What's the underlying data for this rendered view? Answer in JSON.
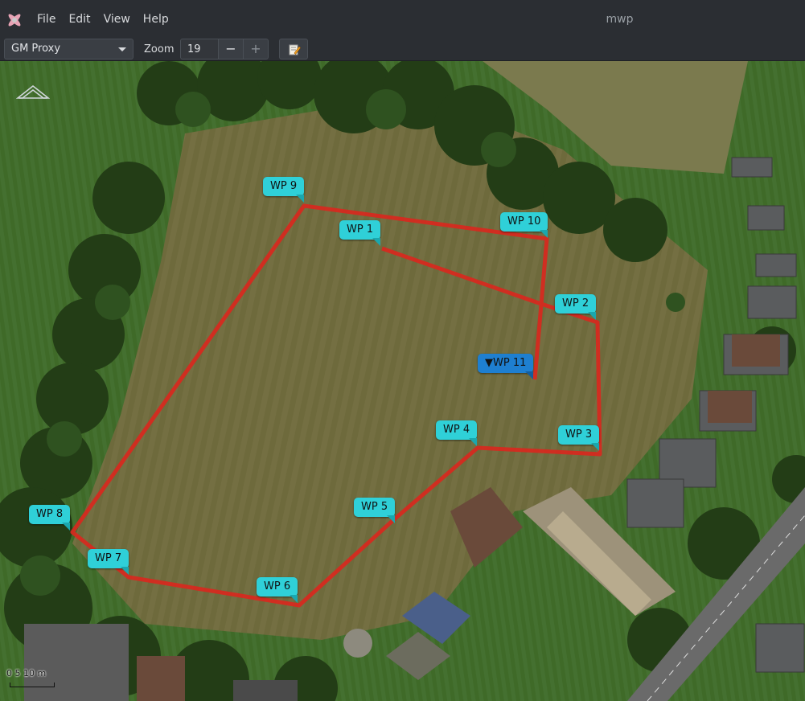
{
  "app": {
    "window_title": "mwp",
    "logo_icon": "app-logo-icon"
  },
  "menu": {
    "items": [
      "File",
      "Edit",
      "View",
      "Help"
    ]
  },
  "toolbar": {
    "map_source": "GM Proxy",
    "zoom_label": "Zoom",
    "zoom_value": "19",
    "zoom_out_label": "−",
    "zoom_in_label": "+",
    "edit_icon": "edit-mission-icon"
  },
  "map": {
    "scale_label": "0  5  10 m",
    "colors": {
      "route": "#d8281e",
      "waypoint": "#2fd0d8",
      "waypoint_active": "#1e7fd0"
    },
    "waypoints": [
      {
        "label": "WP 1"
      },
      {
        "label": "WP 2"
      },
      {
        "label": "WP 3"
      },
      {
        "label": "WP 4"
      },
      {
        "label": "WP 5"
      },
      {
        "label": "WP 6"
      },
      {
        "label": "WP 7"
      },
      {
        "label": "WP 8"
      },
      {
        "label": "WP 9"
      },
      {
        "label": "WP 10"
      },
      {
        "label": "▼WP 11"
      }
    ]
  }
}
